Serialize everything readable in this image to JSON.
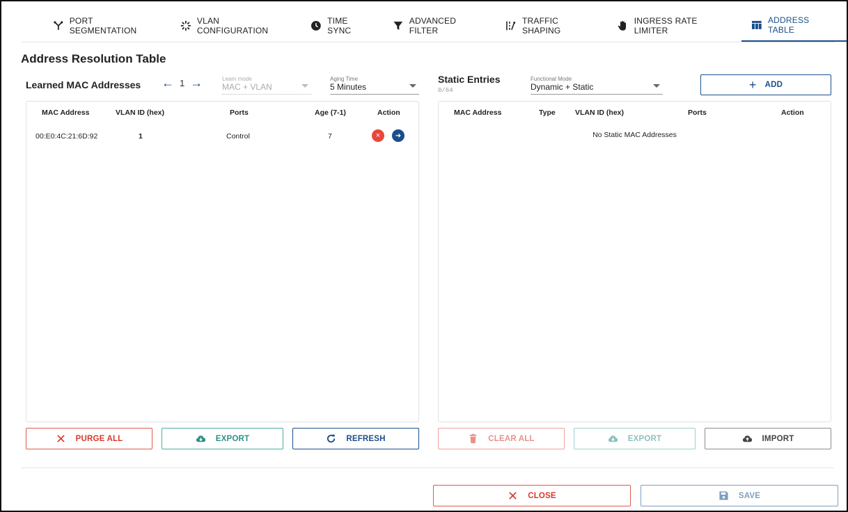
{
  "tabs": [
    {
      "label": "PORT SEGMENTATION",
      "icon": "port-segmentation-icon"
    },
    {
      "label": "VLAN CONFIGURATION",
      "icon": "vlan-icon"
    },
    {
      "label": "TIME SYNC",
      "icon": "clock-icon"
    },
    {
      "label": "ADVANCED FILTER",
      "icon": "filter-icon"
    },
    {
      "label": "TRAFFIC SHAPING",
      "icon": "traffic-shaping-icon"
    },
    {
      "label": "INGRESS RATE LIMITER",
      "icon": "hand-icon"
    },
    {
      "label": "ADDRESS TABLE",
      "icon": "table-icon",
      "active": true
    }
  ],
  "page_title": "Address Resolution Table",
  "learned": {
    "title": "Learned MAC Addresses",
    "page": "1",
    "learn_mode": {
      "label": "Learn mode",
      "value": "MAC + VLAN"
    },
    "aging_time": {
      "label": "Aging Time",
      "value": "5 Minutes"
    },
    "columns": [
      "MAC Address",
      "VLAN ID (hex)",
      "Ports",
      "Age (7-1)",
      "Action"
    ],
    "rows": [
      {
        "mac": "00:E0:4C:21:6D:92",
        "vlan": "1",
        "ports": "Control",
        "age": "7"
      }
    ],
    "buttons": {
      "purge": "PURGE ALL",
      "export": "EXPORT",
      "refresh": "REFRESH"
    }
  },
  "static": {
    "title": "Static Entries",
    "count": "0/64",
    "functional_mode": {
      "label": "Functional Mode",
      "value": "Dynamic + Static"
    },
    "add_label": "ADD",
    "columns": [
      "MAC Address",
      "Type",
      "VLAN ID (hex)",
      "Ports",
      "Action"
    ],
    "empty_text": "No Static MAC Addresses",
    "buttons": {
      "clear": "CLEAR ALL",
      "export": "EXPORT",
      "import": "IMPORT"
    }
  },
  "footer": {
    "close": "CLOSE",
    "save": "SAVE"
  },
  "colors": {
    "accent": "#1a4e8a",
    "danger": "#d9372a",
    "teal": "#2f8f84",
    "delete_circle": "#e8473b",
    "go_circle": "#1a4e8a"
  }
}
